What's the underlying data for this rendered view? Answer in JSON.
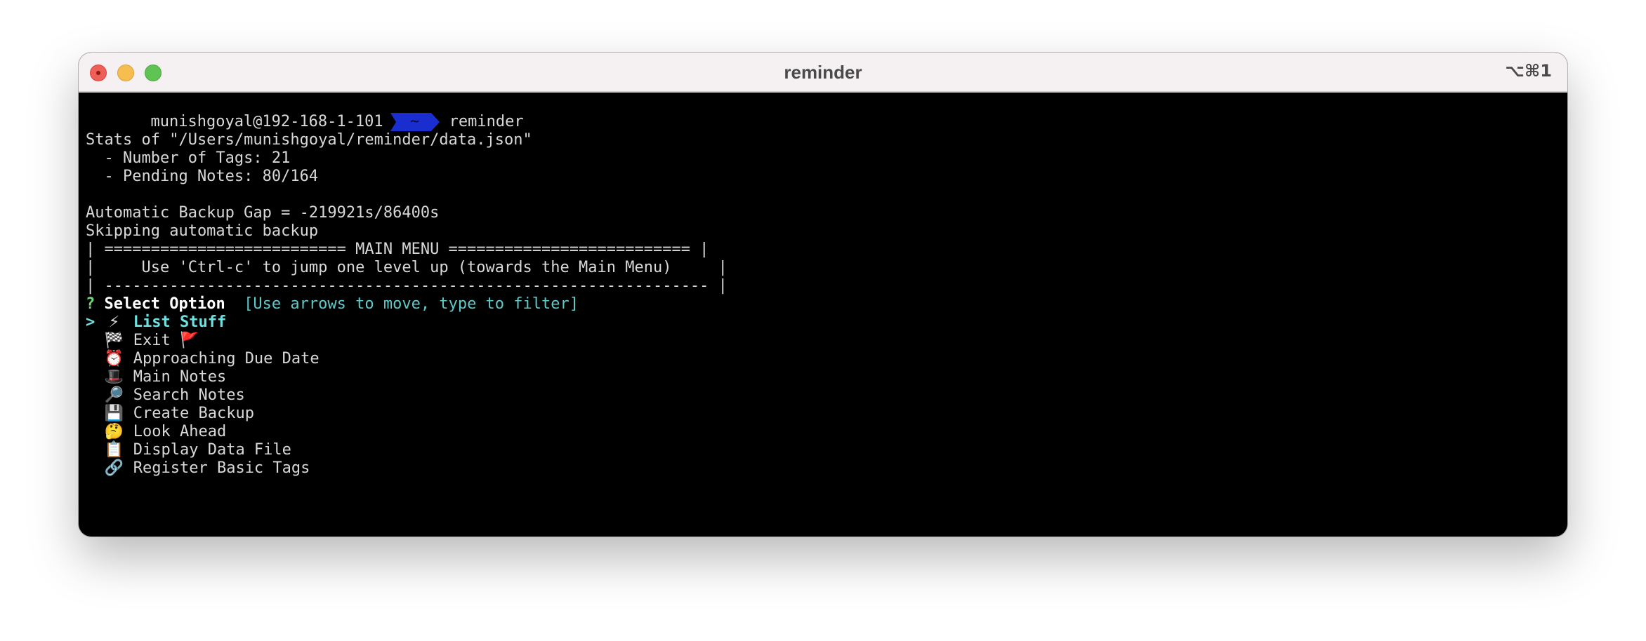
{
  "window": {
    "title": "reminder",
    "shortcut": "⌥⌘1"
  },
  "prompt": {
    "user_host": "munishgoyal@192-168-1-101",
    "dir": "~",
    "command": "reminder",
    "segment_color": "#1a2ecf"
  },
  "stats": {
    "header": "Stats of \"/Users/munishgoyal/reminder/data.json\"",
    "tags": "  - Number of Tags: 21",
    "pending": "  - Pending Notes: 80/164"
  },
  "backup": {
    "gap": "Automatic Backup Gap = -219921s/86400s",
    "skip": "Skipping automatic backup"
  },
  "banner": {
    "line1": "| ========================== MAIN MENU ========================== |",
    "line2": "|     Use 'Ctrl-c' to jump one level up (towards the Main Menu)     |",
    "line3": "| ----------------------------------------------------------------- |"
  },
  "question": {
    "mark": "?",
    "label": "Select Option",
    "hint": "[Use arrows to move, type to filter]"
  },
  "menu": {
    "cursor": ">",
    "items": [
      {
        "icon": "⚡",
        "icon_name": "lightning-icon",
        "label": "List Stuff",
        "selected": true
      },
      {
        "icon": "🏁",
        "icon_name": "checkered-flag-icon",
        "label": "Exit",
        "suffix_icon": "🚩",
        "suffix_icon_name": "red-flag-icon"
      },
      {
        "icon": "⏰",
        "icon_name": "alarm-clock-icon",
        "label": "Approaching Due Date"
      },
      {
        "icon": "🎩",
        "icon_name": "top-hat-icon",
        "label": "Main Notes"
      },
      {
        "icon": "🔎",
        "icon_name": "magnifier-icon",
        "label": "Search Notes"
      },
      {
        "icon": "💾",
        "icon_name": "floppy-disk-icon",
        "label": "Create Backup"
      },
      {
        "icon": "🤔",
        "icon_name": "thinking-face-icon",
        "label": "Look Ahead"
      },
      {
        "icon": "📋",
        "icon_name": "clipboard-icon",
        "label": "Display Data File"
      },
      {
        "icon": "🔗",
        "icon_name": "link-icon",
        "label": "Register Basic Tags"
      }
    ]
  }
}
